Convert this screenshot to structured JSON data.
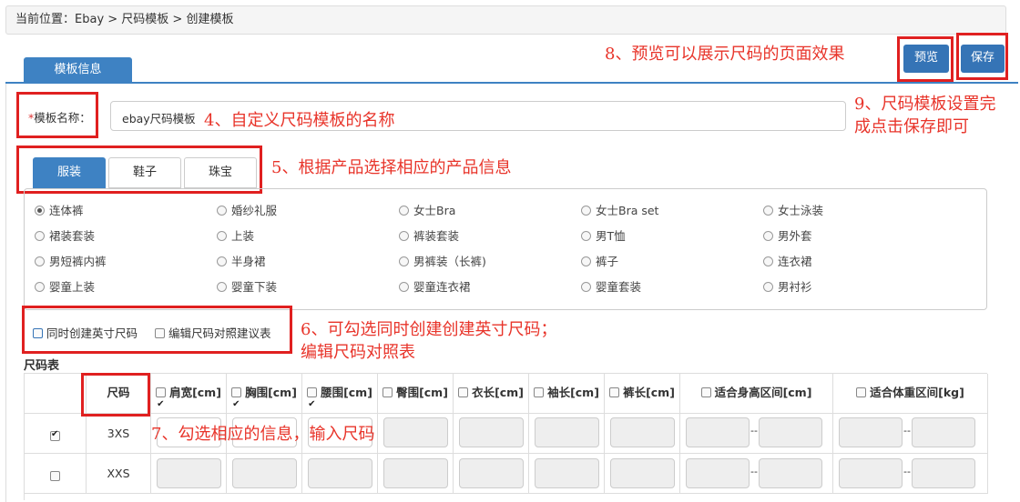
{
  "breadcrumb": {
    "prefix": "当前位置：",
    "path": "Ebay > 尺码模板 > 创建模板"
  },
  "tab": {
    "label": "模板信息"
  },
  "buttons": {
    "preview": "预览",
    "save": "保存"
  },
  "template_name": {
    "label": "*模板名称：",
    "value": "ebay尺码模板"
  },
  "categories": [
    "服装",
    "鞋子",
    "珠宝"
  ],
  "product_types": [
    [
      "连体裤",
      "婚纱礼服",
      "女士Bra",
      "女士Bra set",
      "女士泳装"
    ],
    [
      "裙装套装",
      "上装",
      "裤装套装",
      "男T恤",
      "男外套"
    ],
    [
      "男短裤内裤",
      "半身裙",
      "男裤装（长裤)",
      "裤子",
      "连衣裙"
    ],
    [
      "婴童上装",
      "婴童下装",
      "婴童连衣裙",
      "婴童套装",
      "男衬衫"
    ]
  ],
  "options": {
    "inch": "同时创建英寸尺码",
    "edit": "编辑尺码对照建议表"
  },
  "size_table": {
    "title": "尺码表",
    "size_header": "尺码",
    "columns": [
      "肩宽[cm]",
      "胸围[cm]",
      "腰围[cm]",
      "臀围[cm]",
      "衣长[cm]",
      "袖长[cm]",
      "裤长[cm]",
      "适合身高区间[cm]",
      "适合体重区间[kg]"
    ],
    "rows": [
      "3XS",
      "XXS"
    ],
    "range_sep": "--"
  },
  "annotations": {
    "a4": "4、自定义尺码模板的名称",
    "a5": "5、根据产品选择相应的产品信息",
    "a6_line1": "6、可勾选同时创建创建英寸尺码；",
    "a6_line2": "编辑尺码对照表",
    "a7": "7、勾选相应的信息，输入尺码",
    "a8": "8、预览可以展示尺码的页面效果",
    "a9_line1": "9、尺码模板设置完",
    "a9_line2": "成点击保存即可"
  }
}
